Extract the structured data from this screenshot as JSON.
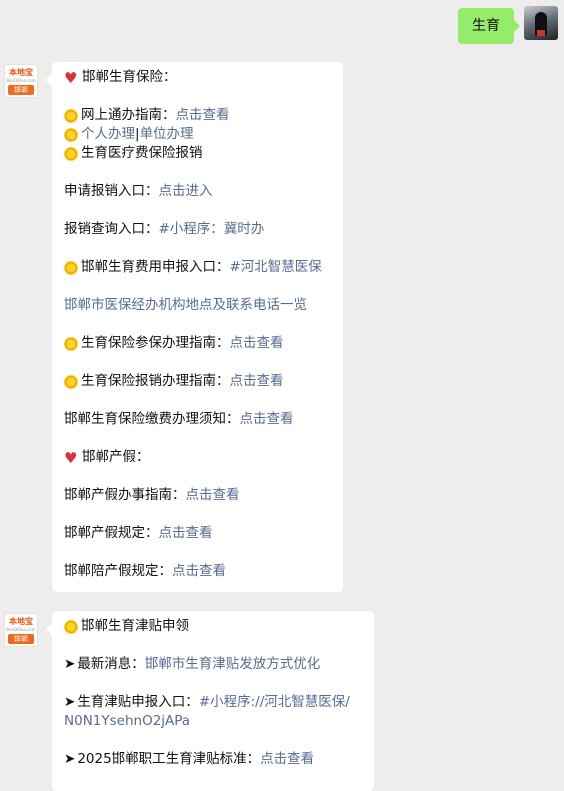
{
  "sent": {
    "text": "生育"
  },
  "bot_avatar": {
    "brand_top": "本地宝",
    "brand_mid": "BenDiBao.com",
    "city": "邯郸"
  },
  "msg1": {
    "title": "邯郸生育保险：",
    "l1_label": "网上通办指南：",
    "l1_link": "点击查看",
    "l2_link_a": "个人办理",
    "l2_sep": " |",
    "l2_link_b": "单位办理",
    "l3_label": "生育医疗费保险报销",
    "l4_label": "申请报销入口：",
    "l4_link": "点击进入",
    "l5_label": "报销查询入口：",
    "l5_link": "#小程序：冀时办",
    "l6_label": "邯郸生育费用申报入口：",
    "l6_link": "#河北智慧医保",
    "l7_link": "邯郸市医保经办机构地点及联系电话一览",
    "l8_label": "生育保险参保办理指南：",
    "l8_link": "点击查看",
    "l9_label": "生育保险报销办理指南：",
    "l9_link": "点击查看",
    "l10_label": "邯郸生育保险缴费办理须知：",
    "l10_link": "点击查看",
    "section2": "邯郸产假：",
    "l11_label": "邯郸产假办事指南：",
    "l11_link": "点击查看",
    "l12_label": "邯郸产假规定：",
    "l12_link": "点击查看",
    "l13_label": "邯郸陪产假规定：",
    "l13_link": "点击查看"
  },
  "msg2": {
    "title": "邯郸生育津贴申领",
    "arrow": "➤",
    "l1_label": "最新消息：",
    "l1_link": "邯郸市生育津贴发放方式优化",
    "l2_label": "生育津贴申报入口：",
    "l2_link_a": "#小程序://河北智慧医保/",
    "l2_link_b": "N0N1YsehnO2jAPa",
    "l3_label": "2025邯郸职工生育津贴标准：",
    "l3_link": "点击查看"
  },
  "icons": {
    "heart": "heart-icon",
    "sun": "sun-emoji-icon"
  },
  "colors": {
    "sent_bubble": "#95ec69",
    "link": "#576b95",
    "background": "#ededed",
    "brand": "#ef6a1f"
  }
}
